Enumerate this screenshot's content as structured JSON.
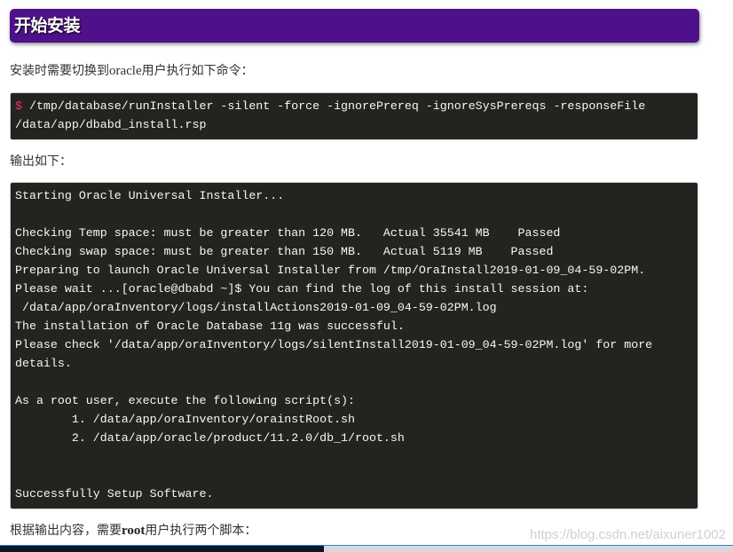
{
  "section": {
    "title": "开始安装"
  },
  "intro": {
    "prefix": "安装时需要切换到",
    "user": "oracle",
    "suffix": "用户执行如下命令："
  },
  "command": {
    "prompt": "$",
    "line1": " /tmp/database/runInstaller -silent -force -ignorePrereq -ignoreSysPrereqs -responseFile",
    "line2": "/data/app/dbabd_install.rsp"
  },
  "output_label": "输出如下：",
  "output": {
    "lines": [
      "Starting Oracle Universal Installer...",
      "",
      "Checking Temp space: must be greater than 120 MB.   Actual 35541 MB    Passed",
      "Checking swap space: must be greater than 150 MB.   Actual 5119 MB    Passed",
      "Preparing to launch Oracle Universal Installer from /tmp/OraInstall2019-01-09_04-59-02PM.",
      "Please wait ...[oracle@dbabd ~]$ You can find the log of this install session at:",
      " /data/app/oraInventory/logs/installActions2019-01-09_04-59-02PM.log",
      "The installation of Oracle Database 11g was successful.",
      "Please check '/data/app/oraInventory/logs/silentInstall2019-01-09_04-59-02PM.log' for more",
      "details.",
      "",
      "As a root user, execute the following script(s):",
      "        1. /data/app/oraInventory/orainstRoot.sh",
      "        2. /data/app/oracle/product/11.2.0/db_1/root.sh",
      "",
      "",
      "Successfully Setup Software."
    ]
  },
  "conclusion": {
    "prefix": "根据输出内容，需要",
    "user": "root",
    "suffix": "用户执行两个脚本："
  },
  "watermark": "https://blog.csdn.net/aixuner1002",
  "colors": {
    "heading_bg": "#4f1189",
    "code_bg": "#23241f",
    "code_text": "#f8f8f2",
    "prompt": "#f92672"
  }
}
